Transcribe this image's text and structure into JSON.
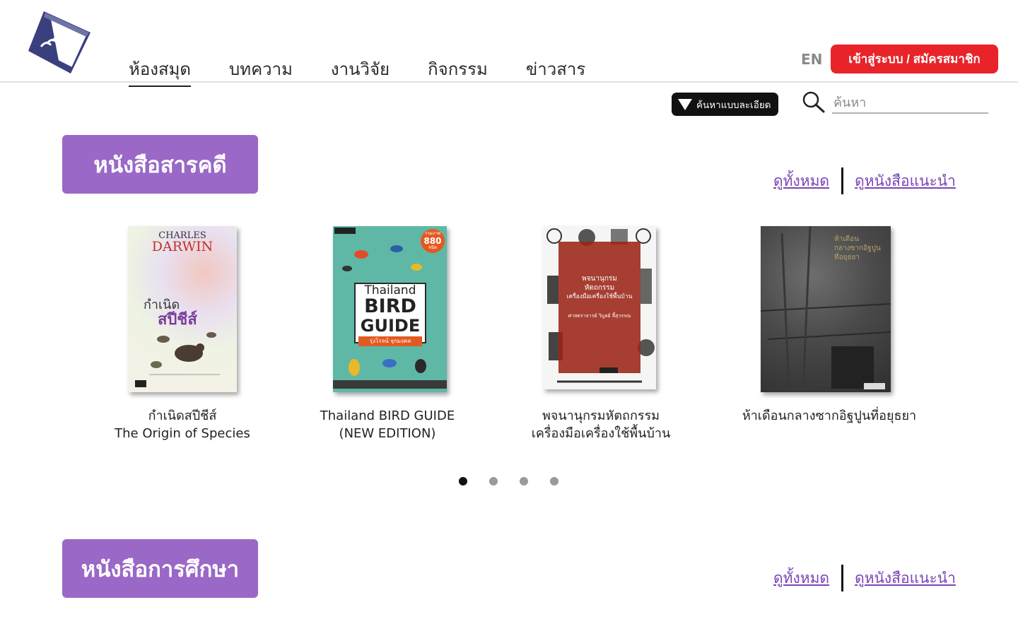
{
  "header": {
    "nav": [
      {
        "label": "ห้องสมุด",
        "active": true
      },
      {
        "label": "บทความ",
        "active": false
      },
      {
        "label": "งานวิจัย",
        "active": false
      },
      {
        "label": "กิจกรรม",
        "active": false
      },
      {
        "label": "ข่าวสาร",
        "active": false
      }
    ],
    "lang": "EN",
    "login_label": "เข้าสู่ระบบ / สมัครสมาชิก"
  },
  "search": {
    "advanced_label": "ค้นหาแบบละเอียด",
    "placeholder": "ค้นหา"
  },
  "sections": [
    {
      "title": "หนังสือสารคดี",
      "view_all": "ดูทั้งหมด",
      "recommended": "ดูหนังสือแนะนำ",
      "books": [
        {
          "title_line1": "กำเนิดสปีชีส์",
          "title_line2": "The Origin of Species",
          "cover_text": {
            "top1": "CHARLES",
            "top2": "DARWIN",
            "main": "กำเนิด",
            "main2": "สปีชีส์"
          }
        },
        {
          "title_line1": "Thailand BIRD GUIDE",
          "title_line2": "(NEW EDITION)",
          "cover_text": {
            "badge1": "รวมภาพ",
            "badge2": "880",
            "badge3": "ชนิด",
            "line1": "Thailand",
            "line2": "BIRD",
            "line3": "GUIDE",
            "author": "รุ่งโรจน์ จุกมงคล"
          }
        },
        {
          "title_line1": "พจนานุกรมหัตถกรรม",
          "title_line2": "เครื่องมือเครื่องใช้พื้นบ้าน",
          "cover_text": {
            "l1": "พจนานุกรม",
            "l2": "หัตถกรรม",
            "l3": "เครื่องมือเครื่องใช้พื้นบ้าน",
            "author": "ศาสตราจารย์ วิบูลย์ ลี้สุวรรณ"
          }
        },
        {
          "title_line1": "ห้าเดือนกลางซากอิฐปูนที่อยุธยา",
          "title_line2": "",
          "cover_text": {
            "l1": "ห้าเดือน",
            "l2": "กลางซากอิฐปูน",
            "l3": "ที่อยุธยา"
          }
        }
      ]
    },
    {
      "title": "หนังสือการศึกษา",
      "view_all": "ดูทั้งหมด",
      "recommended": "ดูหนังสือแนะนำ"
    }
  ],
  "carousel": {
    "pages": 4,
    "active_page": 1
  },
  "colors": {
    "accent": "#9a68c6",
    "login": "#e8242a",
    "link": "#7b44b8"
  }
}
